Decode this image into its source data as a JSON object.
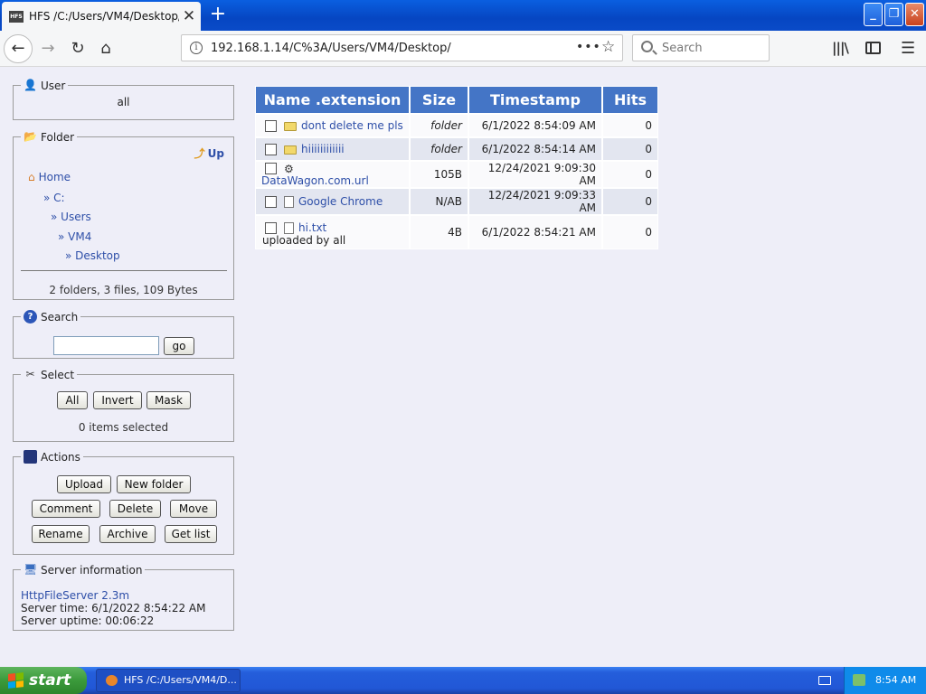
{
  "browser": {
    "tab_title": "HFS /C:/Users/VM4/Desktop/",
    "favicon_text": "HFS",
    "url": "192.168.1.14/C%3A/Users/VM4/Desktop/",
    "search_placeholder": "Search",
    "page_actions": "•••",
    "new_tab": "+",
    "close_tab": "✕",
    "window_controls": {
      "minimize": "_",
      "maximize": "❐",
      "close": "✕"
    }
  },
  "sidebar": {
    "user": {
      "legend": "User",
      "name": "all"
    },
    "folder": {
      "legend": "Folder",
      "up_label": "Up",
      "breadcrumbs": [
        "Home",
        "» C:",
        "» Users",
        "» VM4",
        "» Desktop"
      ],
      "stats": "2 folders, 3 files, 109 Bytes"
    },
    "search": {
      "legend": "Search",
      "go_label": "go"
    },
    "select": {
      "legend": "Select",
      "buttons": [
        "All",
        "Invert",
        "Mask"
      ],
      "count_text": "0 items selected"
    },
    "actions": {
      "legend": "Actions",
      "buttons": [
        "Upload",
        "New folder",
        "Comment",
        "Delete",
        "Move",
        "Rename",
        "Archive",
        "Get list"
      ]
    },
    "server": {
      "legend": "Server information",
      "software": "HttpFileServer 2.3m",
      "time": "Server time: 6/1/2022 8:54:22 AM",
      "uptime": "Server uptime: 00:06:22"
    }
  },
  "file_table": {
    "headers": [
      "Name .extension",
      "Size",
      "Timestamp",
      "Hits"
    ],
    "rows": [
      {
        "name": "dont delete me pls",
        "type": "folder-icon",
        "size": "folder",
        "timestamp": "6/1/2022 8:54:09 AM",
        "hits": "0"
      },
      {
        "name": "hiiiiiiiiiiii",
        "type": "folder-icon",
        "size": "folder",
        "timestamp": "6/1/2022 8:54:14 AM",
        "hits": "0"
      },
      {
        "name": "DataWagon.com.url",
        "type": "link-icon",
        "size": "105B",
        "timestamp": "12/24/2021 9:09:30 AM",
        "hits": "0"
      },
      {
        "name": "Google Chrome",
        "type": "file-icon",
        "size": "N/AB",
        "timestamp": "12/24/2021 9:09:33 AM",
        "hits": "0"
      },
      {
        "name": "hi.txt",
        "type": "file-icon",
        "size": "4B",
        "timestamp": "6/1/2022 8:54:21 AM",
        "hits": "0",
        "note": "uploaded by all"
      }
    ]
  },
  "taskbar": {
    "start_label": "start",
    "task_label": "HFS /C:/Users/VM4/D...",
    "clock": "8:54 AM"
  },
  "colors": {
    "header_bg": "#4475C6",
    "link": "#2E4FA8",
    "page_bg": "#EEEEF8",
    "taskbar": "#245EDB"
  }
}
